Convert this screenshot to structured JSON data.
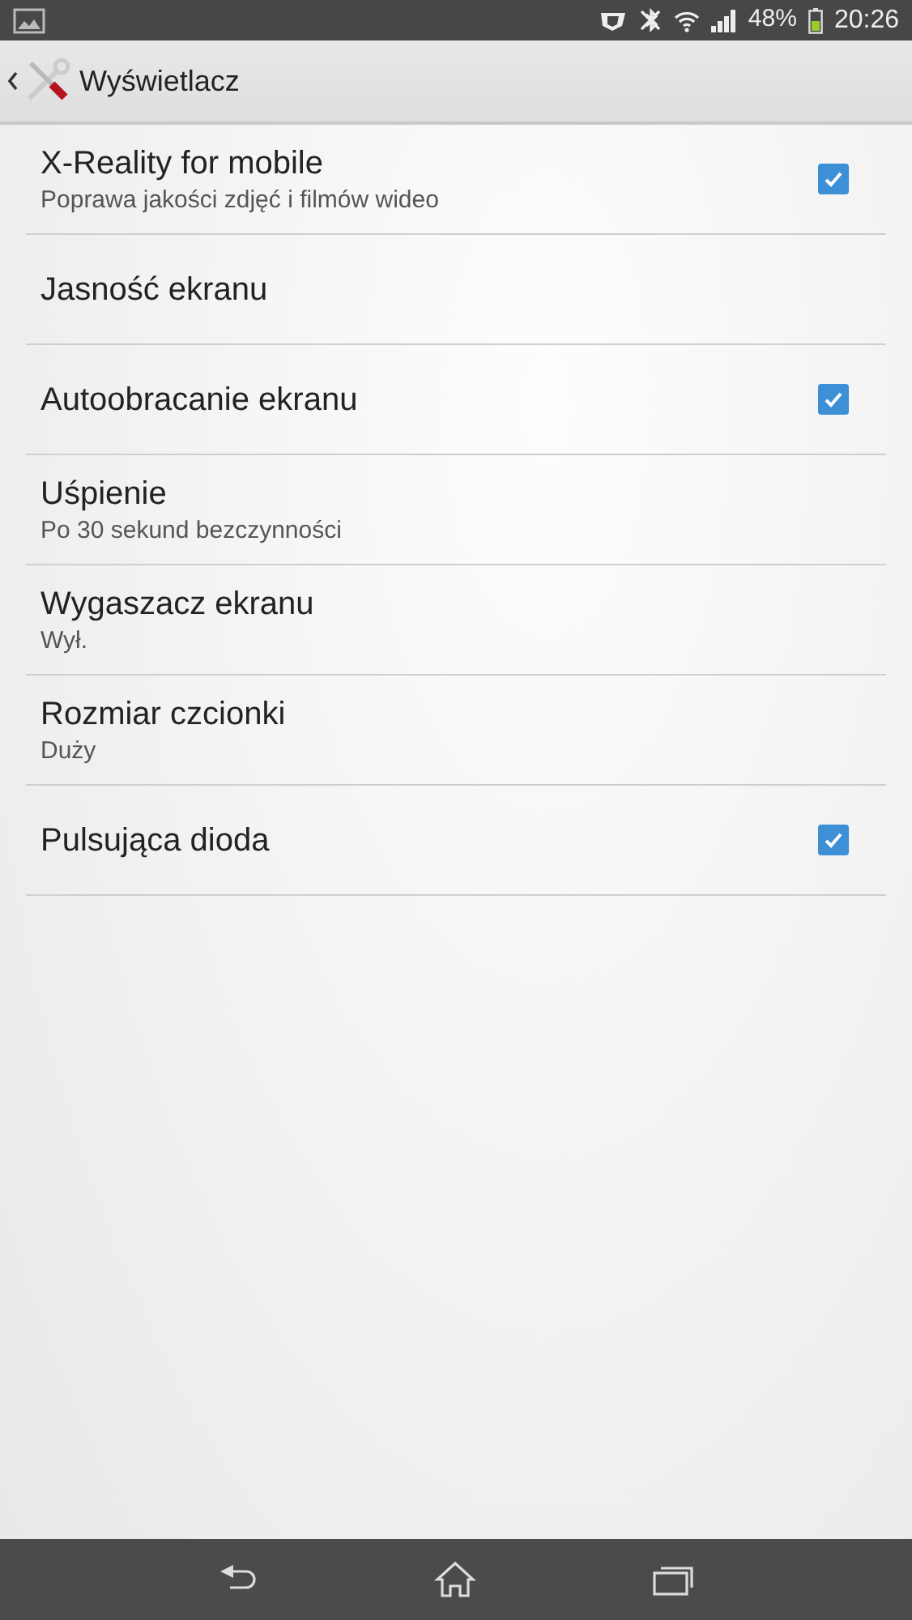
{
  "status_bar": {
    "battery": "48%",
    "time": "20:26"
  },
  "header": {
    "title": "Wyświetlacz"
  },
  "items": [
    {
      "kind": "checkbox",
      "title": "X-Reality for mobile",
      "subtitle": "Poprawa jakości zdjęć i filmów wideo",
      "checked": true
    },
    {
      "kind": "plain",
      "title": "Jasność ekranu"
    },
    {
      "kind": "checkbox",
      "title": "Autoobracanie ekranu",
      "checked": true
    },
    {
      "kind": "plain",
      "title": "Uśpienie",
      "subtitle": "Po 30 sekund bezczynności"
    },
    {
      "kind": "plain",
      "title": "Wygaszacz ekranu",
      "subtitle": "Wył."
    },
    {
      "kind": "plain",
      "title": "Rozmiar czcionki",
      "subtitle": "Duży"
    },
    {
      "kind": "checkbox",
      "title": "Pulsująca dioda",
      "checked": true
    }
  ]
}
